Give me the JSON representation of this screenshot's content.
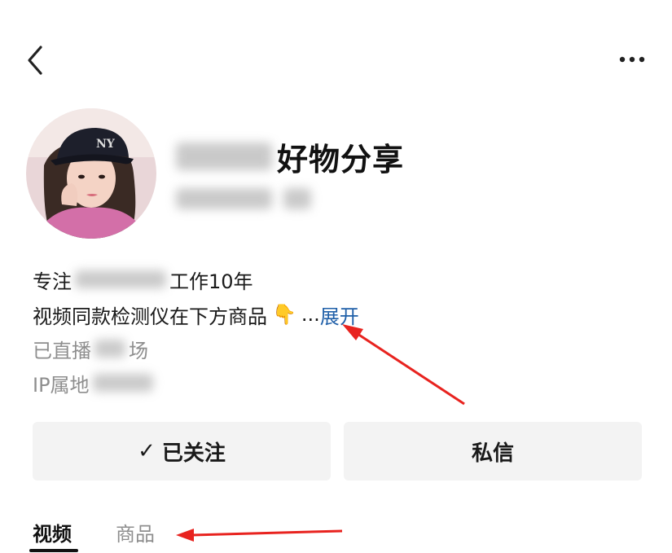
{
  "header": {
    "back_icon": "chevron-left-icon",
    "more_icon": "more-horizontal-icon"
  },
  "profile": {
    "name_suffix": "好物分享",
    "avatar_icon": "user-avatar-photo"
  },
  "bio": {
    "line1_prefix": "专注",
    "line1_suffix": "工作10年",
    "line2_text": "视频同款检测仪在下方商品",
    "line2_emoji": "👇",
    "line2_ellipsis": "...",
    "line2_expand": "展开",
    "line3_prefix": "已直播",
    "line3_suffix": "场",
    "line4_prefix": "IP属地"
  },
  "actions": {
    "follow_check": "✓",
    "follow_label": "已关注",
    "message_label": "私信"
  },
  "tabs": [
    {
      "label": "视频",
      "active": true
    },
    {
      "label": "商品",
      "active": false
    }
  ],
  "annotation_color": "#e8231f"
}
